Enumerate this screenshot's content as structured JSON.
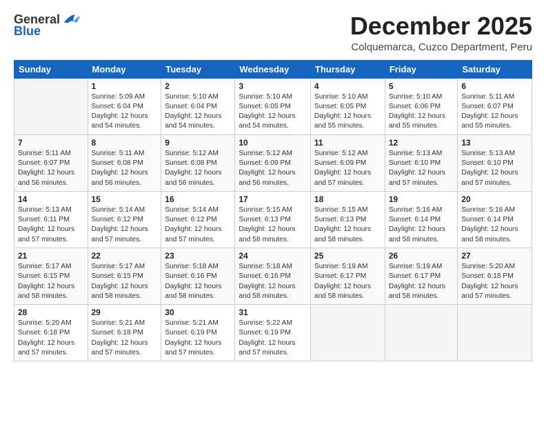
{
  "logo": {
    "general": "General",
    "blue": "Blue"
  },
  "title": "December 2025",
  "subtitle": "Colquemarca, Cuzco Department, Peru",
  "headers": [
    "Sunday",
    "Monday",
    "Tuesday",
    "Wednesday",
    "Thursday",
    "Friday",
    "Saturday"
  ],
  "weeks": [
    [
      {
        "day": "",
        "info": ""
      },
      {
        "day": "1",
        "info": "Sunrise: 5:09 AM\nSunset: 6:04 PM\nDaylight: 12 hours\nand 54 minutes."
      },
      {
        "day": "2",
        "info": "Sunrise: 5:10 AM\nSunset: 6:04 PM\nDaylight: 12 hours\nand 54 minutes."
      },
      {
        "day": "3",
        "info": "Sunrise: 5:10 AM\nSunset: 6:05 PM\nDaylight: 12 hours\nand 54 minutes."
      },
      {
        "day": "4",
        "info": "Sunrise: 5:10 AM\nSunset: 6:05 PM\nDaylight: 12 hours\nand 55 minutes."
      },
      {
        "day": "5",
        "info": "Sunrise: 5:10 AM\nSunset: 6:06 PM\nDaylight: 12 hours\nand 55 minutes."
      },
      {
        "day": "6",
        "info": "Sunrise: 5:11 AM\nSunset: 6:07 PM\nDaylight: 12 hours\nand 55 minutes."
      }
    ],
    [
      {
        "day": "7",
        "info": "Sunrise: 5:11 AM\nSunset: 6:07 PM\nDaylight: 12 hours\nand 56 minutes."
      },
      {
        "day": "8",
        "info": "Sunrise: 5:11 AM\nSunset: 6:08 PM\nDaylight: 12 hours\nand 56 minutes."
      },
      {
        "day": "9",
        "info": "Sunrise: 5:12 AM\nSunset: 6:08 PM\nDaylight: 12 hours\nand 56 minutes."
      },
      {
        "day": "10",
        "info": "Sunrise: 5:12 AM\nSunset: 6:09 PM\nDaylight: 12 hours\nand 56 minutes."
      },
      {
        "day": "11",
        "info": "Sunrise: 5:12 AM\nSunset: 6:09 PM\nDaylight: 12 hours\nand 57 minutes."
      },
      {
        "day": "12",
        "info": "Sunrise: 5:13 AM\nSunset: 6:10 PM\nDaylight: 12 hours\nand 57 minutes."
      },
      {
        "day": "13",
        "info": "Sunrise: 5:13 AM\nSunset: 6:10 PM\nDaylight: 12 hours\nand 57 minutes."
      }
    ],
    [
      {
        "day": "14",
        "info": "Sunrise: 5:13 AM\nSunset: 6:11 PM\nDaylight: 12 hours\nand 57 minutes."
      },
      {
        "day": "15",
        "info": "Sunrise: 5:14 AM\nSunset: 6:12 PM\nDaylight: 12 hours\nand 57 minutes."
      },
      {
        "day": "16",
        "info": "Sunrise: 5:14 AM\nSunset: 6:12 PM\nDaylight: 12 hours\nand 57 minutes."
      },
      {
        "day": "17",
        "info": "Sunrise: 5:15 AM\nSunset: 6:13 PM\nDaylight: 12 hours\nand 58 minutes."
      },
      {
        "day": "18",
        "info": "Sunrise: 5:15 AM\nSunset: 6:13 PM\nDaylight: 12 hours\nand 58 minutes."
      },
      {
        "day": "19",
        "info": "Sunrise: 5:16 AM\nSunset: 6:14 PM\nDaylight: 12 hours\nand 58 minutes."
      },
      {
        "day": "20",
        "info": "Sunrise: 5:16 AM\nSunset: 6:14 PM\nDaylight: 12 hours\nand 58 minutes."
      }
    ],
    [
      {
        "day": "21",
        "info": "Sunrise: 5:17 AM\nSunset: 6:15 PM\nDaylight: 12 hours\nand 58 minutes."
      },
      {
        "day": "22",
        "info": "Sunrise: 5:17 AM\nSunset: 6:15 PM\nDaylight: 12 hours\nand 58 minutes."
      },
      {
        "day": "23",
        "info": "Sunrise: 5:18 AM\nSunset: 6:16 PM\nDaylight: 12 hours\nand 58 minutes."
      },
      {
        "day": "24",
        "info": "Sunrise: 5:18 AM\nSunset: 6:16 PM\nDaylight: 12 hours\nand 58 minutes."
      },
      {
        "day": "25",
        "info": "Sunrise: 5:19 AM\nSunset: 6:17 PM\nDaylight: 12 hours\nand 58 minutes."
      },
      {
        "day": "26",
        "info": "Sunrise: 5:19 AM\nSunset: 6:17 PM\nDaylight: 12 hours\nand 58 minutes."
      },
      {
        "day": "27",
        "info": "Sunrise: 5:20 AM\nSunset: 6:18 PM\nDaylight: 12 hours\nand 57 minutes."
      }
    ],
    [
      {
        "day": "28",
        "info": "Sunrise: 5:20 AM\nSunset: 6:18 PM\nDaylight: 12 hours\nand 57 minutes."
      },
      {
        "day": "29",
        "info": "Sunrise: 5:21 AM\nSunset: 6:18 PM\nDaylight: 12 hours\nand 57 minutes."
      },
      {
        "day": "30",
        "info": "Sunrise: 5:21 AM\nSunset: 6:19 PM\nDaylight: 12 hours\nand 57 minutes."
      },
      {
        "day": "31",
        "info": "Sunrise: 5:22 AM\nSunset: 6:19 PM\nDaylight: 12 hours\nand 57 minutes."
      },
      {
        "day": "",
        "info": ""
      },
      {
        "day": "",
        "info": ""
      },
      {
        "day": "",
        "info": ""
      }
    ]
  ]
}
